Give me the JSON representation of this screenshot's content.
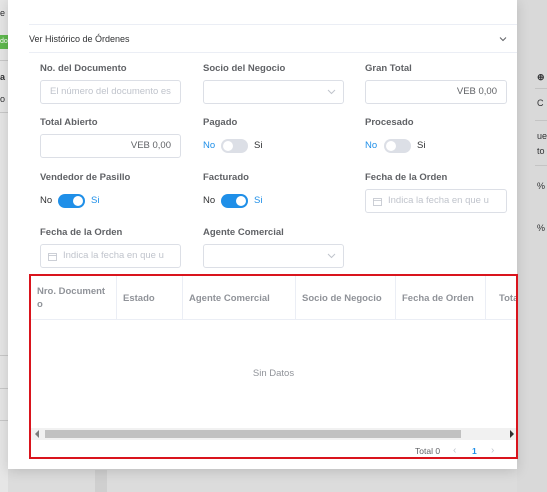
{
  "background": {
    "left_fragments": [
      "e",
      "do",
      "a",
      "o"
    ],
    "right_fragments": [
      "C",
      "ue",
      "to",
      "%",
      "%"
    ]
  },
  "collapse": {
    "title": "Ver Histórico de Órdenes",
    "arrow_icon": "chevron-down-icon"
  },
  "form": {
    "document_no": {
      "label": "No. del Documento",
      "placeholder": "El número del documento es"
    },
    "business_partner": {
      "label": "Socio del Negocio",
      "value": ""
    },
    "grand_total": {
      "label": "Gran Total",
      "value": "VEB 0,00"
    },
    "open_total": {
      "label": "Total Abierto",
      "value": "VEB 0,00"
    },
    "paid": {
      "label": "Pagado",
      "off_label": "No",
      "on_label": "Si",
      "state": false
    },
    "processed": {
      "label": "Procesado",
      "off_label": "No",
      "on_label": "Si",
      "state": false
    },
    "sales_rep": {
      "label": "Vendedor de Pasillo",
      "off_label": "No",
      "on_label": "Si",
      "state": true
    },
    "invoiced": {
      "label": "Facturado",
      "off_label": "No",
      "on_label": "Si",
      "state": true
    },
    "order_date_1": {
      "label": "Fecha de la Orden",
      "placeholder": "Indica la fecha en que u"
    },
    "order_date_2": {
      "label": "Fecha de la Orden",
      "placeholder": "Indica la fecha en que u"
    },
    "commercial_agent": {
      "label": "Agente Comercial",
      "value": ""
    }
  },
  "table": {
    "columns": [
      "Nro. Document o",
      "Estado",
      "Agente Comercial",
      "Socio de Negocio",
      "Fecha de Orden",
      "Tota"
    ],
    "empty_text": "Sin Datos",
    "pagination": {
      "total_label": "Total 0",
      "current_page": "1"
    }
  },
  "colors": {
    "accent": "#1f8fe8",
    "highlight_border": "#d9141d"
  }
}
